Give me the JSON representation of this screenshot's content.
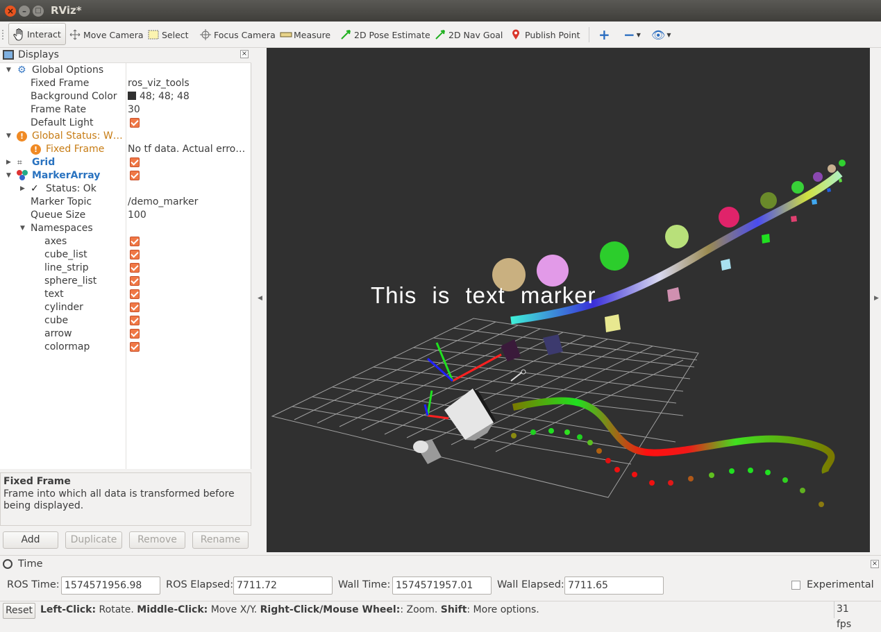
{
  "window": {
    "title": "RViz*"
  },
  "toolbar": {
    "interact": "Interact",
    "move_camera": "Move Camera",
    "select": "Select",
    "focus_camera": "Focus Camera",
    "measure": "Measure",
    "pose_estimate": "2D Pose Estimate",
    "nav_goal": "2D Nav Goal",
    "publish_point": "Publish Point"
  },
  "displays": {
    "title": "Displays",
    "global_options": "Global Options",
    "fixed_frame_label": "Fixed Frame",
    "fixed_frame_value": "ros_viz_tools",
    "background_color_label": "Background Color",
    "background_color_value": "48; 48; 48",
    "frame_rate_label": "Frame Rate",
    "frame_rate_value": "30",
    "default_light_label": "Default Light",
    "global_status": "Global Status: W…",
    "status_fixed_frame": "Fixed Frame",
    "status_fixed_frame_value": "No tf data.  Actual erro…",
    "grid": "Grid",
    "marker_array": "MarkerArray",
    "status_ok": "Status: Ok",
    "marker_topic_label": "Marker Topic",
    "marker_topic_value": "/demo_marker",
    "queue_size_label": "Queue Size",
    "queue_size_value": "100",
    "namespaces": "Namespaces",
    "ns": [
      "axes",
      "cube_list",
      "line_strip",
      "sphere_list",
      "text",
      "cylinder",
      "cube",
      "arrow",
      "colormap"
    ]
  },
  "description": {
    "title": "Fixed Frame",
    "text": "Frame into which all data is transformed before being displayed."
  },
  "buttons": {
    "add": "Add",
    "duplicate": "Duplicate",
    "remove": "Remove",
    "rename": "Rename"
  },
  "viewport": {
    "text_marker": "This is text marker",
    "background": "#303030"
  },
  "time": {
    "title": "Time",
    "ros_time_label": "ROS Time:",
    "ros_time": "1574571956.98",
    "ros_elapsed_label": "ROS Elapsed:",
    "ros_elapsed": "7711.72",
    "wall_time_label": "Wall Time:",
    "wall_time": "1574571957.01",
    "wall_elapsed_label": "Wall Elapsed:",
    "wall_elapsed": "7711.65",
    "experimental": "Experimental"
  },
  "status": {
    "reset": "Reset",
    "left_click": "Left-Click:",
    "left_click_desc": " Rotate. ",
    "middle_click": "Middle-Click:",
    "middle_click_desc": " Move X/Y. ",
    "right_click": "Right-Click/Mouse Wheel:",
    "right_click_desc": ": Zoom. ",
    "shift": "Shift",
    "shift_desc": ": More options.",
    "fps": "31 fps"
  }
}
